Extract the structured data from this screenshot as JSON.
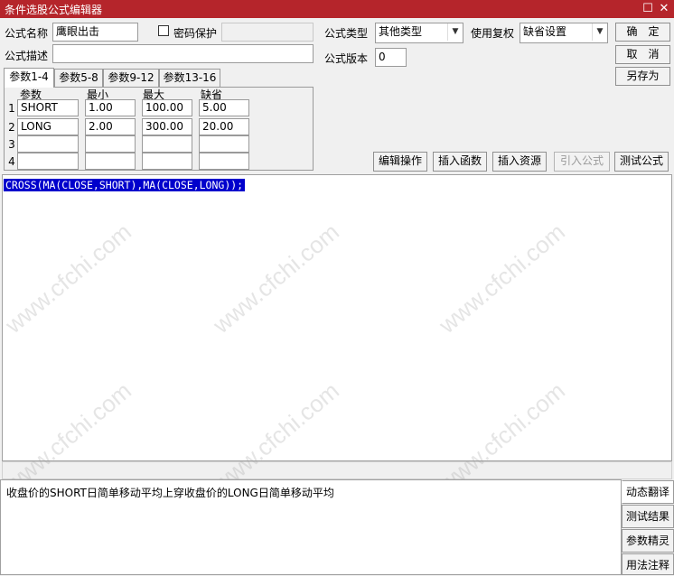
{
  "window": {
    "title": "条件选股公式编辑器",
    "restore_glyph": "☐",
    "close_glyph": "✕"
  },
  "form": {
    "name_label": "公式名称",
    "name_value": "鹰眼出击",
    "password_label": "密码保护",
    "password_value": "",
    "desc_label": "公式描述",
    "desc_value": "",
    "type_label": "公式类型",
    "type_value": "其他类型",
    "fuquan_label": "使用复权",
    "fuquan_value": "缺省设置",
    "version_label": "公式版本",
    "version_value": "0"
  },
  "buttons": {
    "ok": "确　定",
    "cancel": "取　消",
    "save_as": "另存为",
    "edit_ops": "编辑操作",
    "insert_func": "插入函数",
    "insert_res": "插入资源",
    "import_formula": "引入公式",
    "test_formula": "测试公式"
  },
  "tabs": [
    "参数1-4",
    "参数5-8",
    "参数9-12",
    "参数13-16"
  ],
  "params": {
    "headers": [
      "参数",
      "最小",
      "最大",
      "缺省"
    ],
    "rows": [
      {
        "num": "1",
        "name": "SHORT",
        "min": "1.00",
        "max": "100.00",
        "default": "5.00"
      },
      {
        "num": "2",
        "name": "LONG",
        "min": "2.00",
        "max": "300.00",
        "default": "20.00"
      },
      {
        "num": "3",
        "name": "",
        "min": "",
        "max": "",
        "default": ""
      },
      {
        "num": "4",
        "name": "",
        "min": "",
        "max": "",
        "default": ""
      }
    ]
  },
  "editor": {
    "code": "CROSS(MA(CLOSE,SHORT),MA(CLOSE,LONG));"
  },
  "description": {
    "text": "收盘价的SHORT日简单移动平均上穿收盘价的LONG日简单移动平均"
  },
  "side_buttons": [
    "动态翻译",
    "测试结果",
    "参数精灵",
    "用法注释"
  ],
  "watermark": "www.cfchi.com"
}
